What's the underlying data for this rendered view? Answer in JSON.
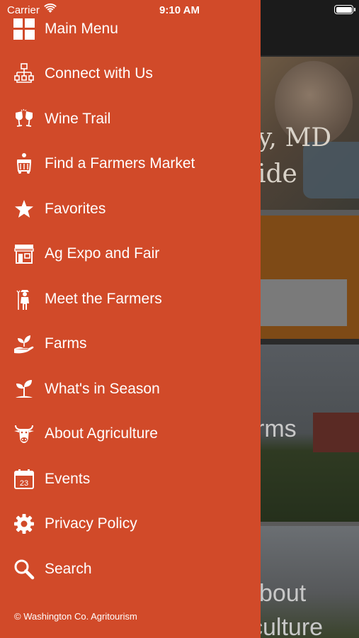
{
  "status_bar": {
    "carrier": "Carrier",
    "time": "9:10 AM"
  },
  "menu": {
    "items": [
      {
        "label": "Main Menu",
        "icon": "grid-icon"
      },
      {
        "label": "Connect with Us",
        "icon": "sitemap-icon"
      },
      {
        "label": "Wine Trail",
        "icon": "wine-glasses-icon"
      },
      {
        "label": "Find a Farmers Market",
        "icon": "market-basket-icon"
      },
      {
        "label": "Favorites",
        "icon": "star-icon"
      },
      {
        "label": "Ag Expo and Fair",
        "icon": "storefront-icon"
      },
      {
        "label": "Meet the Farmers",
        "icon": "farmer-icon"
      },
      {
        "label": "Farms",
        "icon": "hand-plant-icon"
      },
      {
        "label": "What's in Season",
        "icon": "sprout-icon"
      },
      {
        "label": "About Agriculture",
        "icon": "cow-icon"
      },
      {
        "label": "Events",
        "icon": "calendar-icon"
      },
      {
        "label": "Privacy Policy",
        "icon": "gear-icon"
      },
      {
        "label": "Search",
        "icon": "search-icon"
      }
    ],
    "calendar_day": "23",
    "footer": "© Washington Co. Agritourism"
  },
  "background": {
    "hero_line1": "y, MD",
    "hero_line2": "ide",
    "farms_title": "rms",
    "about_line1": "bout",
    "about_line2": "culture"
  },
  "colors": {
    "drawer": "#d14a29",
    "accent_orange": "#7e4a16"
  }
}
